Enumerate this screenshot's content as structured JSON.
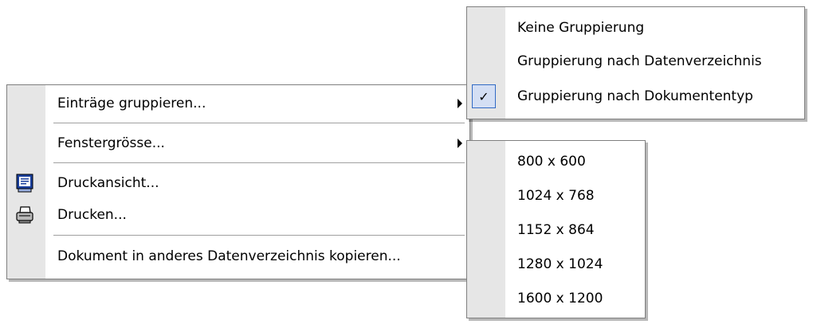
{
  "main_menu": {
    "items": [
      {
        "label": "Einträge gruppieren...",
        "has_submenu": true
      },
      {
        "label": "Fenstergrösse...",
        "has_submenu": true
      },
      {
        "label": "Druckansicht...",
        "icon": "print-preview-icon"
      },
      {
        "label": "Drucken...",
        "icon": "printer-icon"
      },
      {
        "label": "Dokument in anderes Datenverzeichnis kopieren..."
      }
    ]
  },
  "group_submenu": {
    "items": [
      {
        "label": "Keine Gruppierung",
        "checked": false
      },
      {
        "label": "Gruppierung nach Datenverzeichnis",
        "checked": false
      },
      {
        "label": "Gruppierung nach Dokumententyp",
        "checked": true
      }
    ],
    "check_glyph": "✓"
  },
  "size_submenu": {
    "items": [
      {
        "label": "800 x 600"
      },
      {
        "label": "1024 x 768"
      },
      {
        "label": "1152 x 864"
      },
      {
        "label": "1280 x 1024"
      },
      {
        "label": "1600 x 1200"
      }
    ]
  },
  "colors": {
    "menu_background": "#ffffff",
    "icon_strip": "#e6e6e6",
    "border": "#7f7f7f",
    "check_highlight": "#d4dff4"
  }
}
